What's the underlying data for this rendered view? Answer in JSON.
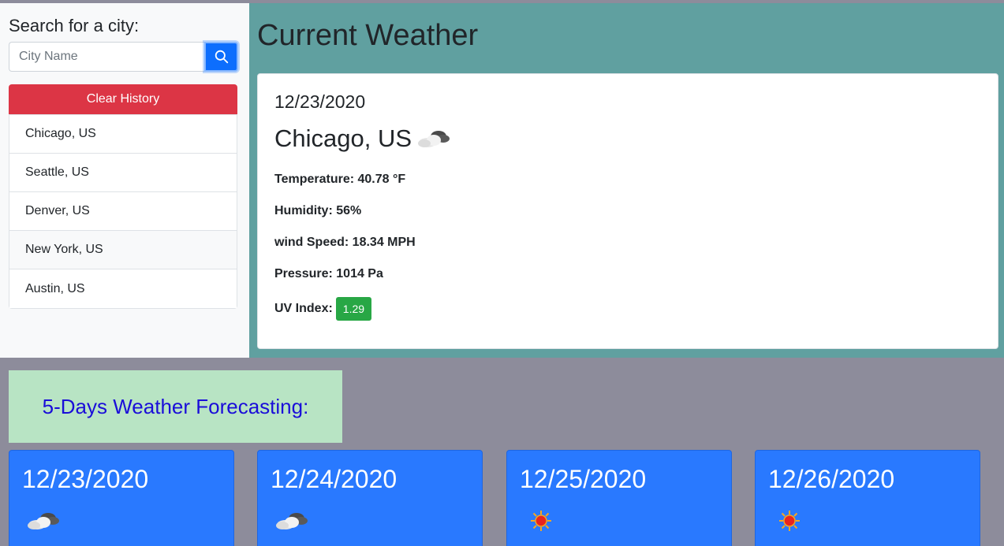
{
  "sidebar": {
    "search_label": "Search for a city:",
    "search_placeholder": "City Name",
    "search_button_icon": "search-icon",
    "clear_label": "Clear History",
    "history": [
      "Chicago, US",
      "Seattle, US",
      "Denver, US",
      "New York, US",
      "Austin, US"
    ]
  },
  "current": {
    "title": "Current Weather",
    "date": "12/23/2020",
    "city": "Chicago, US",
    "icon": "cloudy-icon",
    "temperature": "Temperature: 40.78 °F",
    "humidity": "Humidity: 56%",
    "wind": "wind Speed: 18.34 MPH",
    "pressure": "Pressure: 1014 Pa",
    "uv_label": "UV Index:",
    "uv_value": "1.29",
    "uv_color": "#28a745"
  },
  "forecast": {
    "title": "5-Days Weather Forecasting:",
    "days": [
      {
        "date": "12/23/2020",
        "icon": "cloudy-icon"
      },
      {
        "date": "12/24/2020",
        "icon": "cloudy-icon"
      },
      {
        "date": "12/25/2020",
        "icon": "sun-icon"
      },
      {
        "date": "12/26/2020",
        "icon": "sun-icon"
      }
    ]
  },
  "colors": {
    "page_bg": "#8d8c9b",
    "current_bg": "#60a0a0",
    "forecast_card": "#2979ff",
    "clear_button": "#dc3545",
    "forecast_header_bg": "#b8e4c4",
    "forecast_header_text": "#1a0dd9"
  }
}
